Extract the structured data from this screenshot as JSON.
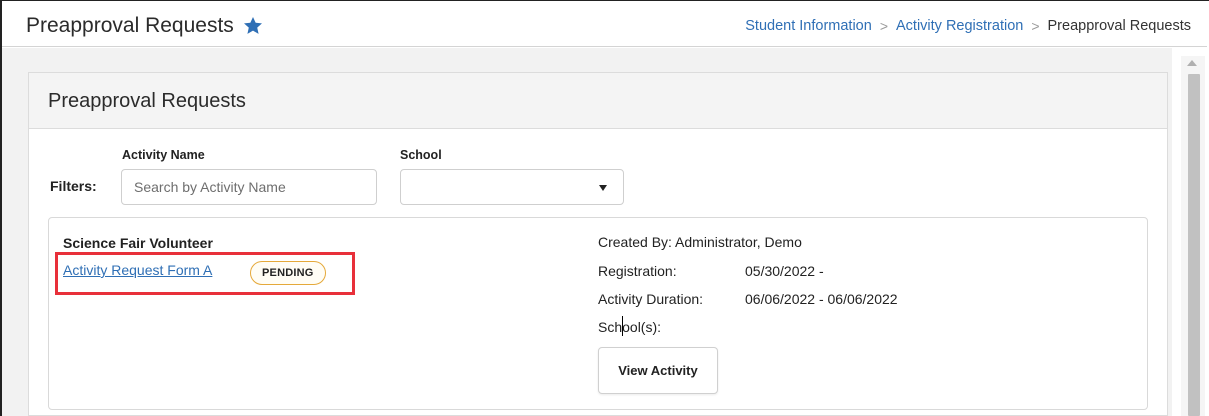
{
  "header": {
    "title": "Preapproval Requests",
    "breadcrumb": {
      "items": [
        "Student Information",
        "Activity Registration"
      ],
      "current": "Preapproval Requests",
      "separator": ">"
    }
  },
  "panel": {
    "title": "Preapproval Requests"
  },
  "filters": {
    "label": "Filters:",
    "activity_name": {
      "label": "Activity Name",
      "placeholder": "Search by Activity Name",
      "value": ""
    },
    "school": {
      "label": "School",
      "selected": ""
    }
  },
  "request": {
    "activity_name": "Science Fair Volunteer",
    "form_link": "Activity Request Form A",
    "status": "PENDING",
    "created_by": "Created By: Administrator, Demo",
    "registration_label": "Registration:",
    "registration_value": "05/30/2022 -",
    "duration_label": "Activity Duration:",
    "duration_value": "06/06/2022 - 06/06/2022",
    "schools_label": "School(s):",
    "view_button": "View Activity"
  },
  "colors": {
    "link": "#2f6fb5",
    "star": "#2f6fb5",
    "badge_border": "#e5a93a",
    "highlight": "#e8303a"
  },
  "icons": {
    "favorite": "star-icon",
    "dropdown": "chevron-down-icon"
  }
}
